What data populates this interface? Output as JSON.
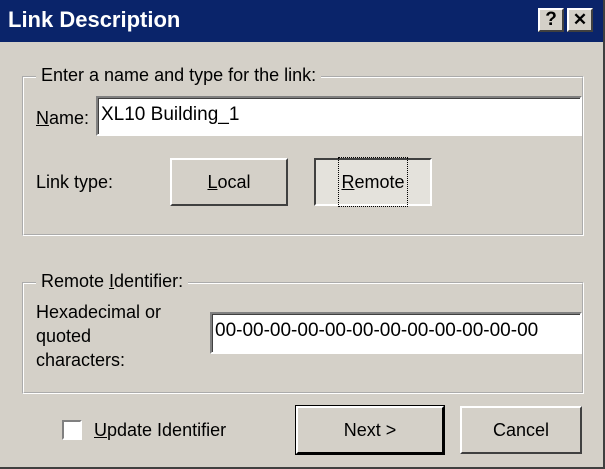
{
  "window": {
    "title": "Link Description",
    "help_label": "?",
    "close_label": "✕"
  },
  "link_group": {
    "legend": "Enter a name and type for the link:",
    "name_label_accel": "N",
    "name_label_rest": "ame:",
    "name_value": "XL10 Building_1",
    "link_type_label": "Link type:",
    "local_accel": "L",
    "local_rest": "ocal",
    "remote_accel": "R",
    "remote_rest": "emote",
    "selected": "Remote"
  },
  "remote_group": {
    "legend_pre": "Remote ",
    "legend_accel": "I",
    "legend_post": "dentifier:",
    "hex_label_line1": "Hexadecimal or",
    "hex_label_line2": "quoted",
    "hex_label_line3": "characters:",
    "identifier_value": "00-00-00-00-00-00-00-00-00-00-00-00"
  },
  "footer": {
    "update_accel": "U",
    "update_rest": "pdate Identifier",
    "update_checked": false,
    "next_label": "Next >",
    "cancel_label": "Cancel"
  }
}
